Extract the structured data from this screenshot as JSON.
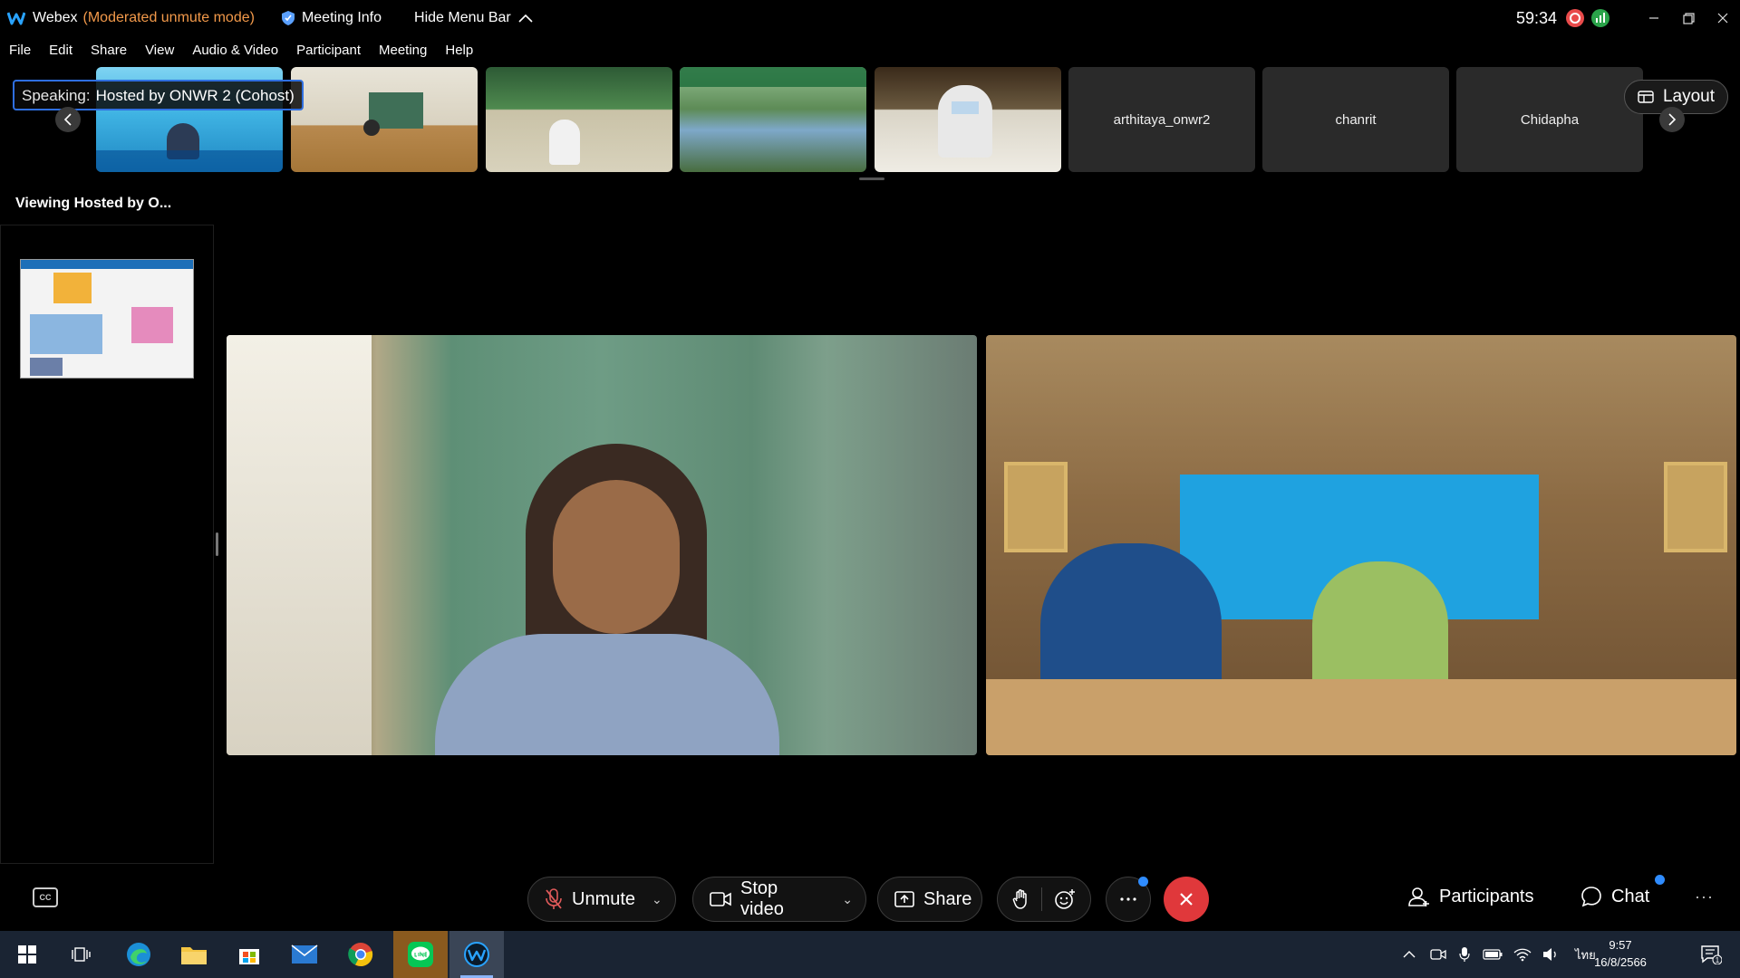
{
  "titlebar": {
    "app_name": "Webex",
    "mode": "(Moderated unmute mode)",
    "meeting_info": "Meeting Info",
    "hide_menu_bar": "Hide Menu Bar",
    "timer": "59:34",
    "colors": {
      "mode": "#f2994a",
      "recording": "#e94b4b",
      "stats": "#2aa34a"
    }
  },
  "menu": {
    "items": [
      "File",
      "Edit",
      "Share",
      "View",
      "Audio & Video",
      "Participant",
      "Meeting",
      "Help"
    ]
  },
  "strip": {
    "speaking_label": "Speaking:",
    "speaking_name": "Hosted by ONWR 2 (Cohost)",
    "name_tiles": [
      "arthitaya_onwr2",
      "chanrit",
      "Chidapha"
    ],
    "layout_label": "Layout"
  },
  "viewing_label": "Viewing Hosted by O...",
  "controls": {
    "unmute": "Unmute",
    "stop_video": "Stop video",
    "share": "Share",
    "participants": "Participants",
    "chat": "Chat",
    "cc_label": "CC",
    "end_color": "#e0383b"
  },
  "taskbar": {
    "time": "9:57",
    "date": "16/8/2566",
    "language": "ไทย",
    "notification_count": "1"
  }
}
